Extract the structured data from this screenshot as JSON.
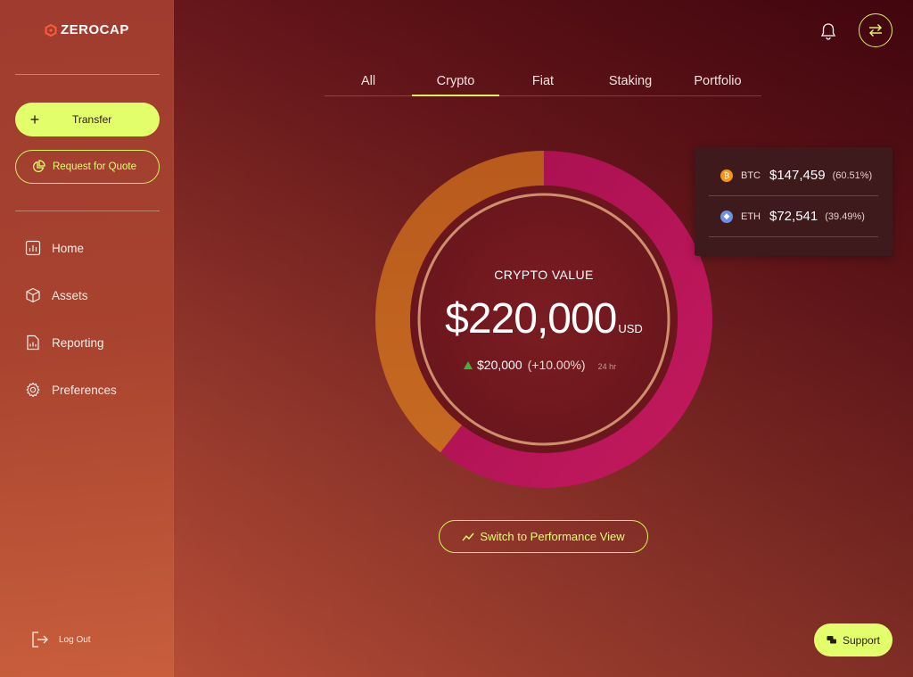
{
  "brand": {
    "name": "ZEROCAP"
  },
  "sidebar": {
    "transfer_label": "Transfer",
    "rfq_label": "Request for Quote",
    "items": [
      {
        "label": "Home",
        "icon": "chart-icon"
      },
      {
        "label": "Assets",
        "icon": "cube-icon"
      },
      {
        "label": "Reporting",
        "icon": "report-icon"
      },
      {
        "label": "Preferences",
        "icon": "gear-icon"
      }
    ],
    "logout_label": "Log Out"
  },
  "tabs": [
    {
      "label": "All"
    },
    {
      "label": "Crypto"
    },
    {
      "label": "Fiat"
    },
    {
      "label": "Staking"
    },
    {
      "label": "Portfolio"
    }
  ],
  "active_tab": "Crypto",
  "summary": {
    "title": "CRYPTO VALUE",
    "amount": "$220,000",
    "currency": "USD",
    "change_amount": "$20,000",
    "change_pct": "(+10.00%)",
    "period": "24 hr"
  },
  "breakdown": [
    {
      "symbol": "BTC",
      "value": "$147,459",
      "share": "(60.51%)",
      "color": "#f2941d",
      "share_fraction": 0.6051
    },
    {
      "symbol": "ETH",
      "value": "$72,541",
      "share": "(39.49%)",
      "color": "#6f8fe0",
      "share_fraction": 0.3949
    }
  ],
  "donut_colors": {
    "btc": "#b8125a",
    "eth": "#c0651f"
  },
  "perf_button_label": "Switch to Performance View",
  "support_label": "Support",
  "colors": {
    "accent": "#e2ff6b",
    "accent_outline": "#d8f25a"
  }
}
